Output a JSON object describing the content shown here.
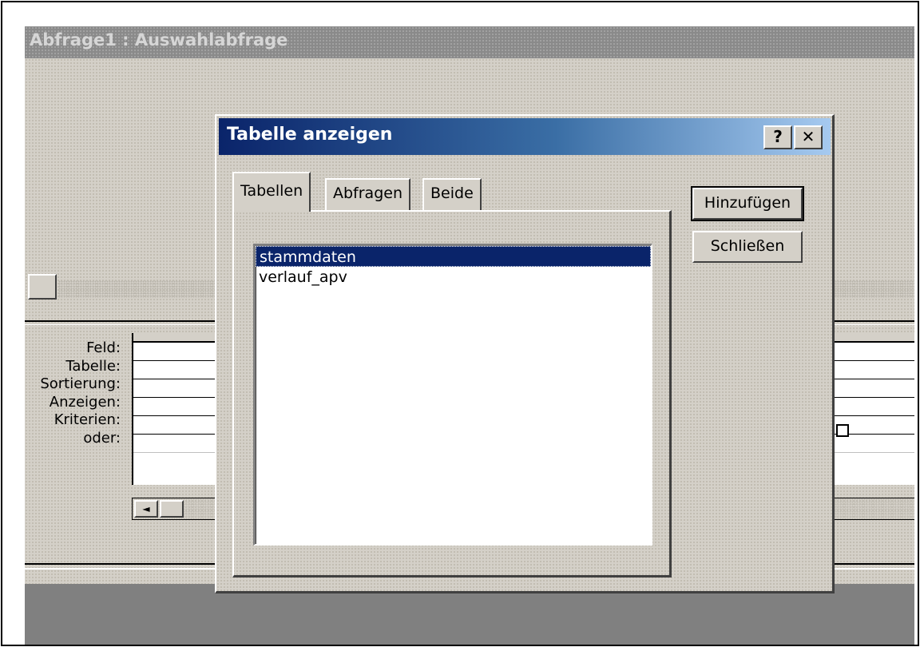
{
  "query_window": {
    "title": "Abfrage1 : Auswahlabfrage",
    "grid_labels": [
      "Feld:",
      "Tabelle:",
      "Sortierung:",
      "Anzeigen:",
      "Kriterien:",
      "oder:"
    ],
    "scroll_left_icon": "◄"
  },
  "dialog": {
    "title": "Tabelle anzeigen",
    "help_label": "?",
    "close_label": "✕",
    "tabs": [
      {
        "label": "Tabellen",
        "active": true
      },
      {
        "label": "Abfragen",
        "active": false
      },
      {
        "label": "Beide",
        "active": false
      }
    ],
    "list_items": [
      {
        "label": "stammdaten",
        "selected": true
      },
      {
        "label": "verlauf_apv",
        "selected": false
      }
    ],
    "add_button": "Hinzufügen",
    "close_button": "Schließen"
  },
  "colors": {
    "dialog_title_start": "#0a246a",
    "dialog_title_end": "#a6caf0",
    "selection": "#0a246a",
    "window_face": "#d4d0c8"
  }
}
